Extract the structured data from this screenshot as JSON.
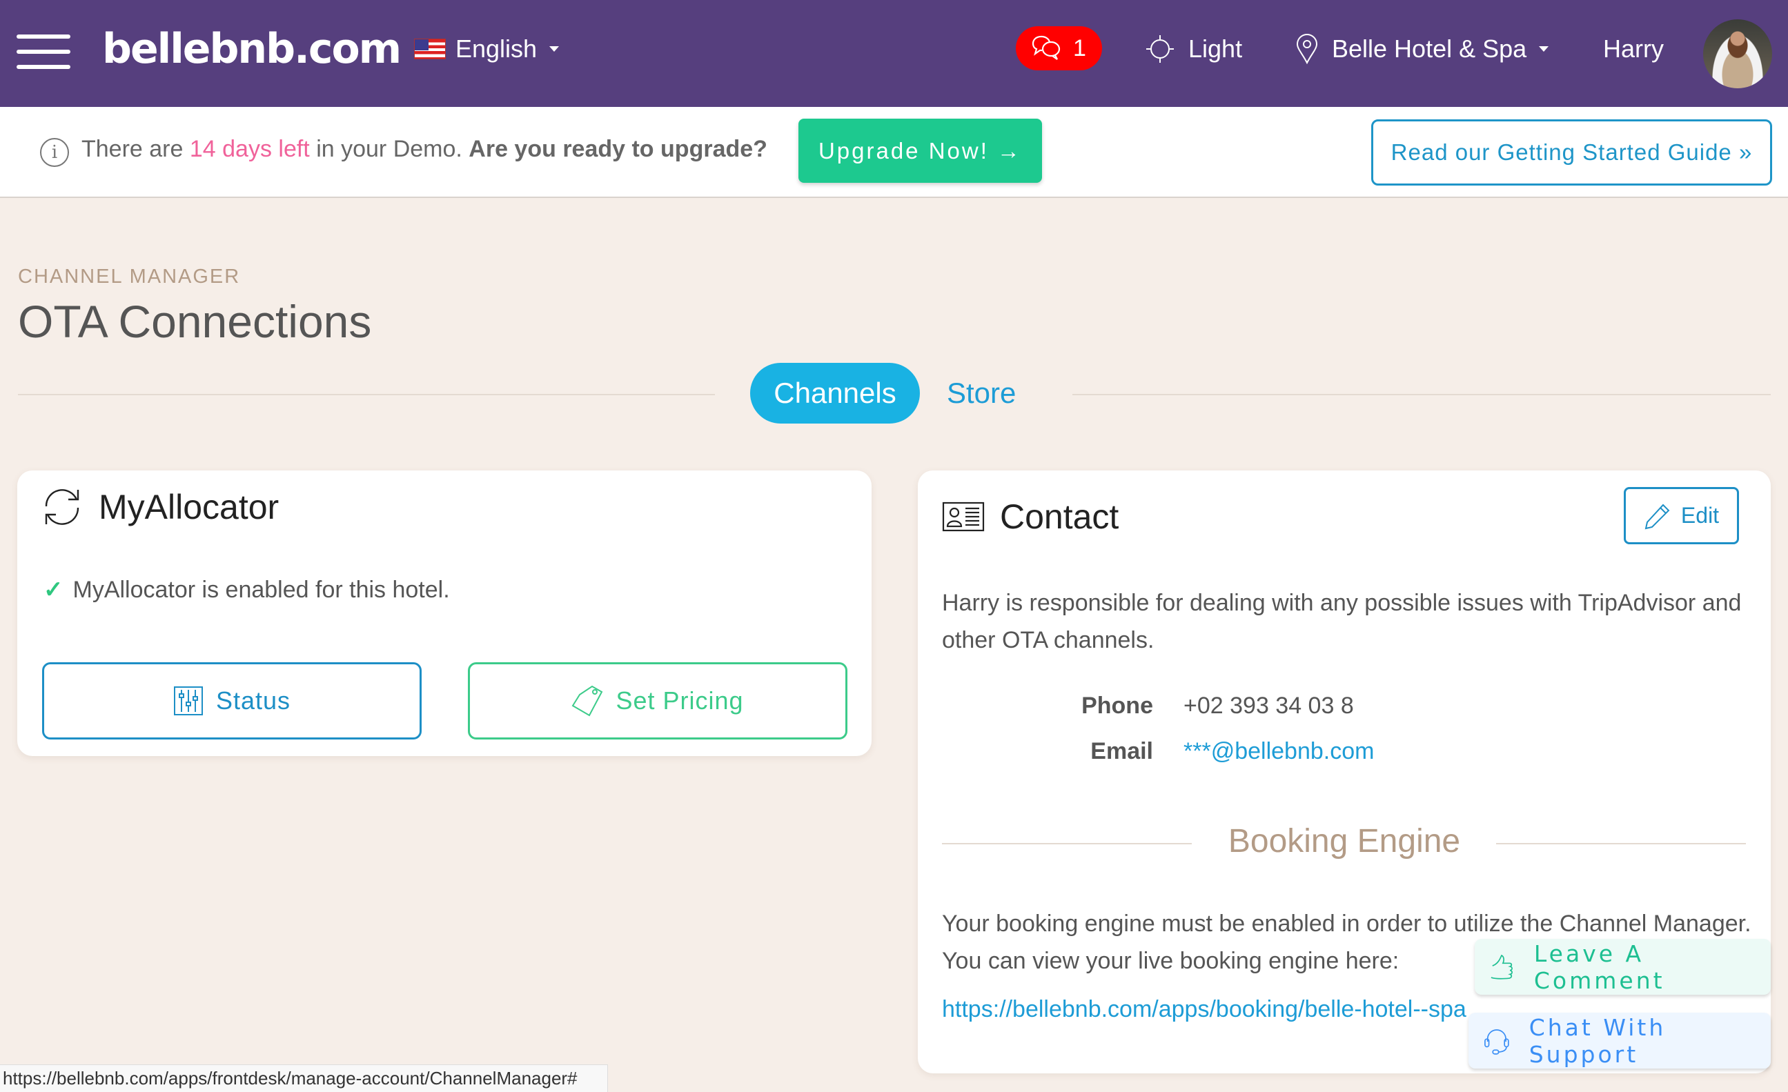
{
  "header": {
    "logo": "bellebnb.com",
    "language": "English",
    "messages_count": "1",
    "theme_label": "Light",
    "hotel_name": "Belle Hotel & Spa",
    "user_name": "Harry",
    "colors": {
      "background": "#563f7e",
      "badge": "#ff0000"
    }
  },
  "banner": {
    "text_before": "There are ",
    "highlight": "14 days left",
    "text_after": " in your Demo. ",
    "question": "Are you ready to upgrade?",
    "upgrade_button": "Upgrade Now! →",
    "guide_button": "Read our Getting Started Guide »"
  },
  "page": {
    "eyebrow": "CHANNEL MANAGER",
    "title": "OTA Connections"
  },
  "tabs": [
    {
      "label": "Channels",
      "active": true
    },
    {
      "label": "Store",
      "active": false
    }
  ],
  "myallocator": {
    "title": "MyAllocator",
    "status_text": "MyAllocator is enabled for this hotel.",
    "status_button": "Status",
    "pricing_button": "Set Pricing"
  },
  "contact": {
    "title": "Contact",
    "edit_button": "Edit",
    "description": "Harry is responsible for dealing with any possible issues with TripAdvisor and other OTA channels.",
    "phone_label": "Phone",
    "phone_value": "+02 393 34 03 8",
    "email_label": "Email",
    "email_value": "***@bellebnb.com",
    "booking_engine_title": "Booking Engine",
    "booking_engine_desc": "Your booking engine must be enabled in order to utilize the Channel Manager. You can view your live booking engine here:",
    "booking_engine_link": "https://bellebnb.com/apps/booking/belle-hotel--spa"
  },
  "floating": {
    "comment": "Leave A Comment",
    "chat": "Chat With Support"
  },
  "statusbar": {
    "url": "https://bellebnb.com/apps/frontdesk/manage-account/ChannelManager#"
  }
}
